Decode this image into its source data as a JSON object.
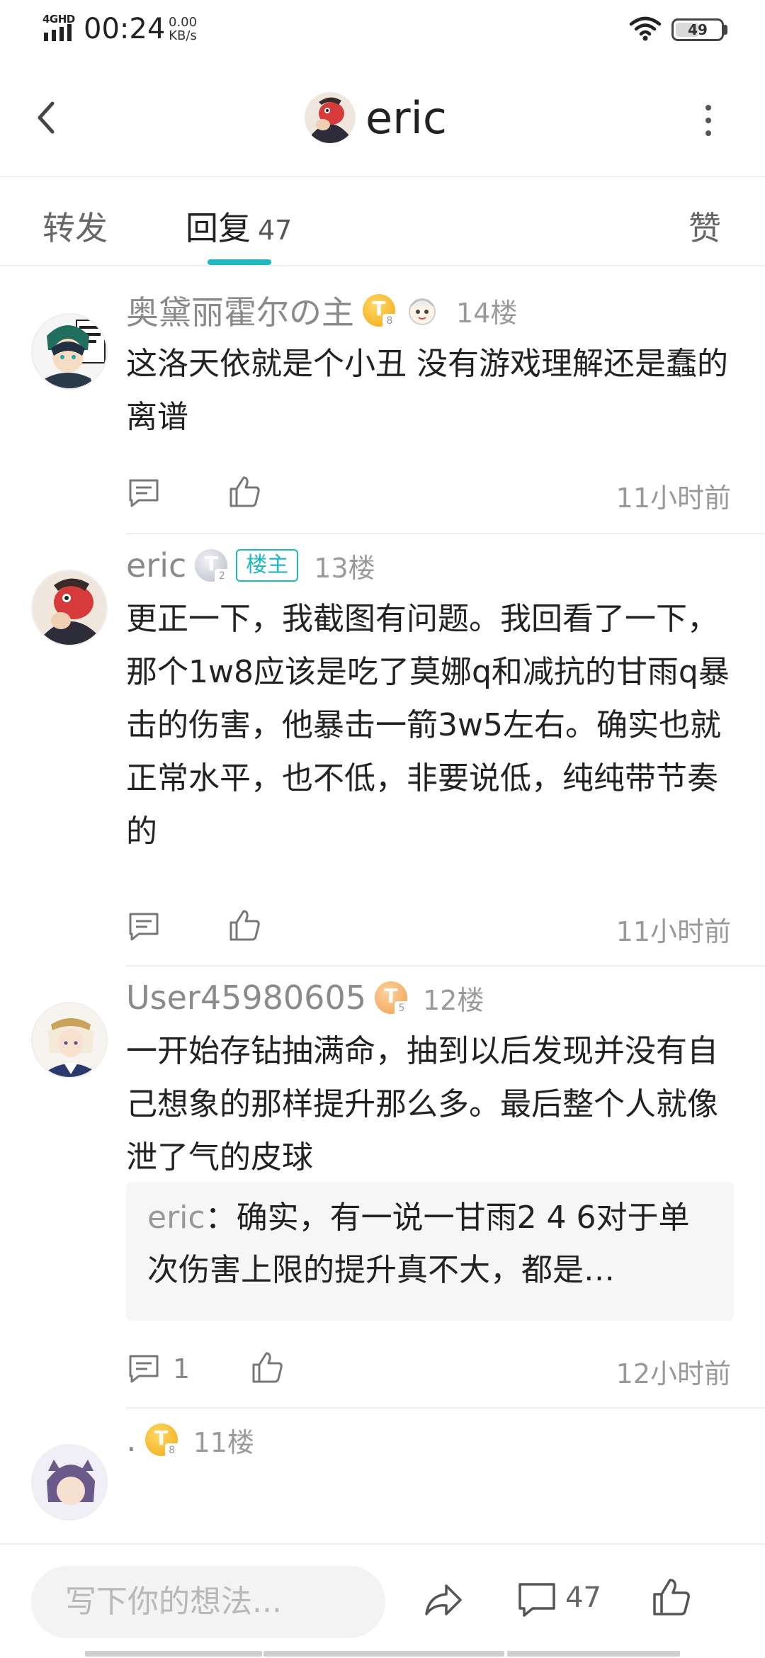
{
  "status_bar": {
    "network": "4GHD",
    "time": "00:24",
    "speed_value": "0.00",
    "speed_unit": "KB/s",
    "battery": "49"
  },
  "header": {
    "title": "eric",
    "back_icon": "back-chevron-icon",
    "more_icon": "more-vertical-icon"
  },
  "tabs": {
    "forward": "转发",
    "reply": "回复",
    "reply_count": "47",
    "like": "赞",
    "active": "reply",
    "accent_color": "#1cb8c3"
  },
  "comments": [
    {
      "name": "奥黛丽霍尔の主",
      "level": "T",
      "level_sub": "8",
      "floor": "14楼",
      "text": "这洛天依就是个小丑 没有游戏理解还是蠢的离谱",
      "time": "11小时前"
    },
    {
      "name": "eric",
      "level": "T",
      "level_sub": "2",
      "owner_tag": "楼主",
      "floor": "13楼",
      "text": "更正一下，我截图有问题。我回看了一下，那个1w8应该是吃了莫娜q和减抗的甘雨q暴击的伤害，他暴击一箭3w5左右。确实也就正常水平，也不低，非要说低，纯纯带节奏的",
      "time": "11小时前"
    },
    {
      "name": "User45980605",
      "level": "T",
      "level_sub": "5",
      "floor": "12楼",
      "text": "一开始存钻抽满命，抽到以后发现并没有自己想象的那样提升那么多。最后整个人就像泄了气的皮球",
      "reply_name": "eric",
      "reply_sep": "：",
      "reply_text": "确实，有一说一甘雨2 4 6对于单次伤害上限的提升真不大，都是…",
      "reply_count": "1",
      "time": "12小时前"
    },
    {
      "name": ".",
      "level": "T",
      "level_sub": "8",
      "floor": "11楼"
    }
  ],
  "bottom_bar": {
    "placeholder": "写下你的想法...",
    "comment_count": "47"
  }
}
